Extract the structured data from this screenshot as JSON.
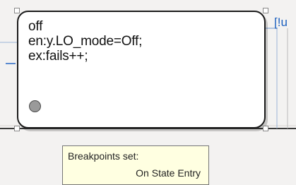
{
  "state": {
    "lines": [
      "off",
      "en:y.LO_mode=Off;",
      "ex:fails++;"
    ]
  },
  "transition": {
    "label": "[!u"
  },
  "tooltip": {
    "title": "Breakpoints set:",
    "value": "On State Entry"
  },
  "colors": {
    "canvas": "#f3f2f1",
    "state_border": "#1b1b1b",
    "transition": "#1a5fbf",
    "tooltip_bg": "#ffffe1"
  }
}
